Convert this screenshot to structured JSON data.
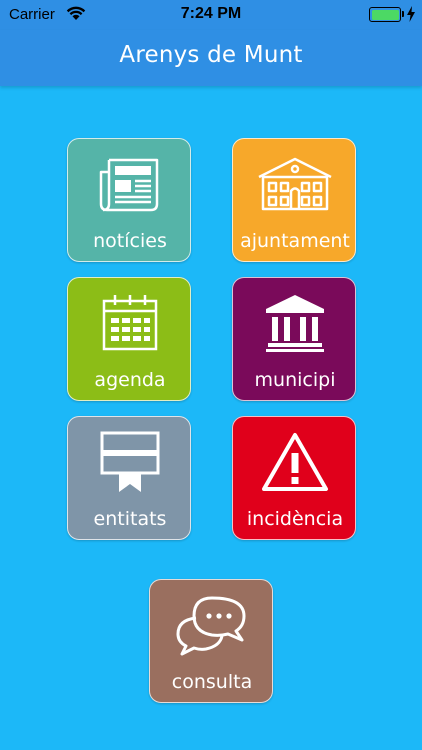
{
  "status_bar": {
    "carrier": "Carrier",
    "time": "7:24 PM"
  },
  "nav": {
    "title": "Arenys de Munt"
  },
  "tiles": [
    {
      "label": "notícies",
      "icon": "newspaper-icon",
      "color": "#55b4a8"
    },
    {
      "label": "ajuntament",
      "icon": "town-hall-icon",
      "color": "#f7a82a"
    },
    {
      "label": "agenda",
      "icon": "calendar-icon",
      "color": "#8cbd17"
    },
    {
      "label": "municipi",
      "icon": "columns-building-icon",
      "color": "#7a0a5a"
    },
    {
      "label": "entitats",
      "icon": "ribbon-banner-icon",
      "color": "#7f95a8"
    },
    {
      "label": "incidència",
      "icon": "warning-icon",
      "color": "#e0001b"
    },
    {
      "label": "consulta",
      "icon": "chat-bubbles-icon",
      "color": "#9a6f5f"
    }
  ],
  "colors": {
    "background": "#1cb8f8",
    "nav_bar": "#2f8fe4",
    "battery": "#4cd964"
  }
}
